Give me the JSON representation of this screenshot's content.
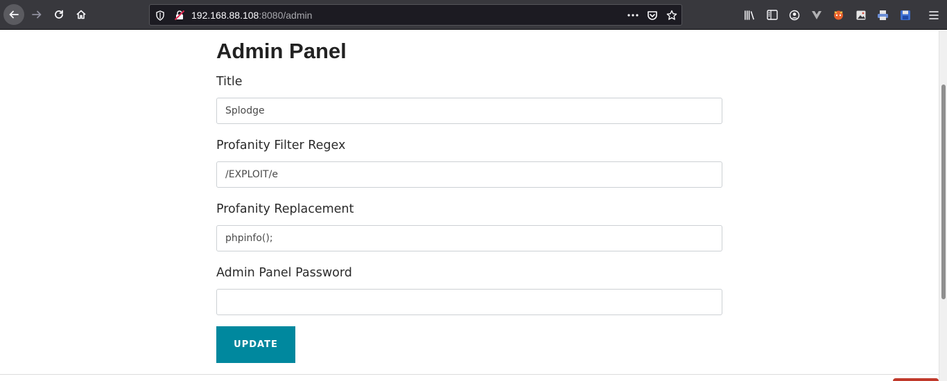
{
  "browser": {
    "url": {
      "host": "192.168.88.108",
      "rest": ":8080/admin"
    },
    "icons": [
      "back-arrow-icon",
      "forward-arrow-icon",
      "reload-icon",
      "home-icon",
      "shield-icon",
      "insecure-lock-icon",
      "more-dots-icon",
      "pocket-icon",
      "star-icon",
      "library-icon",
      "sidebar-icon",
      "account-icon",
      "vue-devtools-icon",
      "extension-fox-icon",
      "extension-image-icon",
      "extension-printer-icon",
      "extension-save-icon",
      "menu-icon"
    ]
  },
  "page": {
    "title": "Admin Panel",
    "fields": [
      {
        "label": "Title",
        "value": "Splodge"
      },
      {
        "label": "Profanity Filter Regex",
        "value": "/EXPLOIT/e"
      },
      {
        "label": "Profanity Replacement",
        "value": "phpinfo();"
      },
      {
        "label": "Admin Panel Password",
        "value": ""
      }
    ],
    "submit_label": "UPDATE"
  },
  "colors": {
    "toolbar": "#38383d",
    "urlbar": "#1c1b22",
    "button": "#00889e",
    "text": "#222222"
  }
}
